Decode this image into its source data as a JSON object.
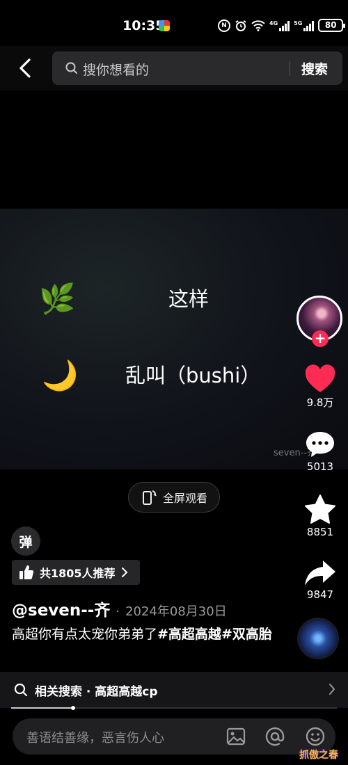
{
  "status_bar": {
    "time": "10:35",
    "network_a": "4G",
    "network_b": "5G",
    "nfc_label": "N",
    "battery": "80"
  },
  "search": {
    "placeholder": "搜你想看的",
    "button_label": "搜索"
  },
  "video": {
    "lyrics": [
      {
        "emoji": "🌿",
        "text": "这样"
      },
      {
        "emoji": "🌙",
        "text": "乱叫（bushi）"
      }
    ],
    "watermark": "seven--齐",
    "fullscreen_label": "全屏观看"
  },
  "actions": {
    "follow_symbol": "+",
    "likes": "9.8万",
    "comments": "5013",
    "favorites": "8851",
    "shares": "9847"
  },
  "info": {
    "danmu_label": "弹",
    "recommend_label": "共1805人推荐",
    "author": "@seven--齐",
    "date_separator": "·",
    "date": "2024年08月30日",
    "caption_text": "高超你有点太宠你弟弟了",
    "hashtags": [
      "#高超高越",
      "#双高胎"
    ]
  },
  "related": {
    "label": "相关搜索 · 高超高越cp"
  },
  "progress": {
    "fraction": 0.19
  },
  "comment": {
    "placeholder": "善语结善缘，恶言伤人心"
  },
  "corner_logo": "抓傲之春",
  "colors": {
    "accent_red": "#fe2c55",
    "background": "#000000"
  }
}
